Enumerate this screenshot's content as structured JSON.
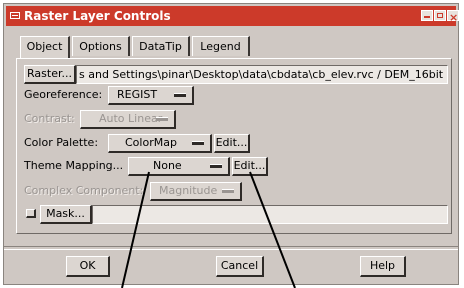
{
  "window": {
    "title": "Raster Layer Controls"
  },
  "tabs": [
    {
      "label": "Object",
      "active": true
    },
    {
      "label": "Options",
      "active": false
    },
    {
      "label": "DataTip",
      "active": false
    },
    {
      "label": "Legend",
      "active": false
    }
  ],
  "raster": {
    "button_label": "Raster...",
    "path": "s and Settings\\pinar\\Desktop\\data\\cbdata\\cb_elev.rvc / DEM_16bit"
  },
  "georeference": {
    "label": "Georeference:",
    "value": "REGIST"
  },
  "contrast": {
    "label": "Contrast:",
    "value": "Auto Linear",
    "enabled": false
  },
  "color_palette": {
    "label": "Color Palette:",
    "value": "ColorMap",
    "edit_label": "Edit..."
  },
  "theme_mapping": {
    "label": "Theme Mapping...",
    "value": "None",
    "edit_label": "Edit..."
  },
  "complex_component": {
    "label": "Complex Component:",
    "value": "Magnitude",
    "enabled": false
  },
  "mask": {
    "button_label": "Mask...",
    "value": "",
    "checked": false
  },
  "footer": {
    "ok_label": "OK",
    "cancel_label": "Cancel",
    "help_label": "Help"
  },
  "colors": {
    "titlebar": "#cc3a2a",
    "dialog_bg": "#cfc8c3",
    "pointer": "#000000"
  }
}
